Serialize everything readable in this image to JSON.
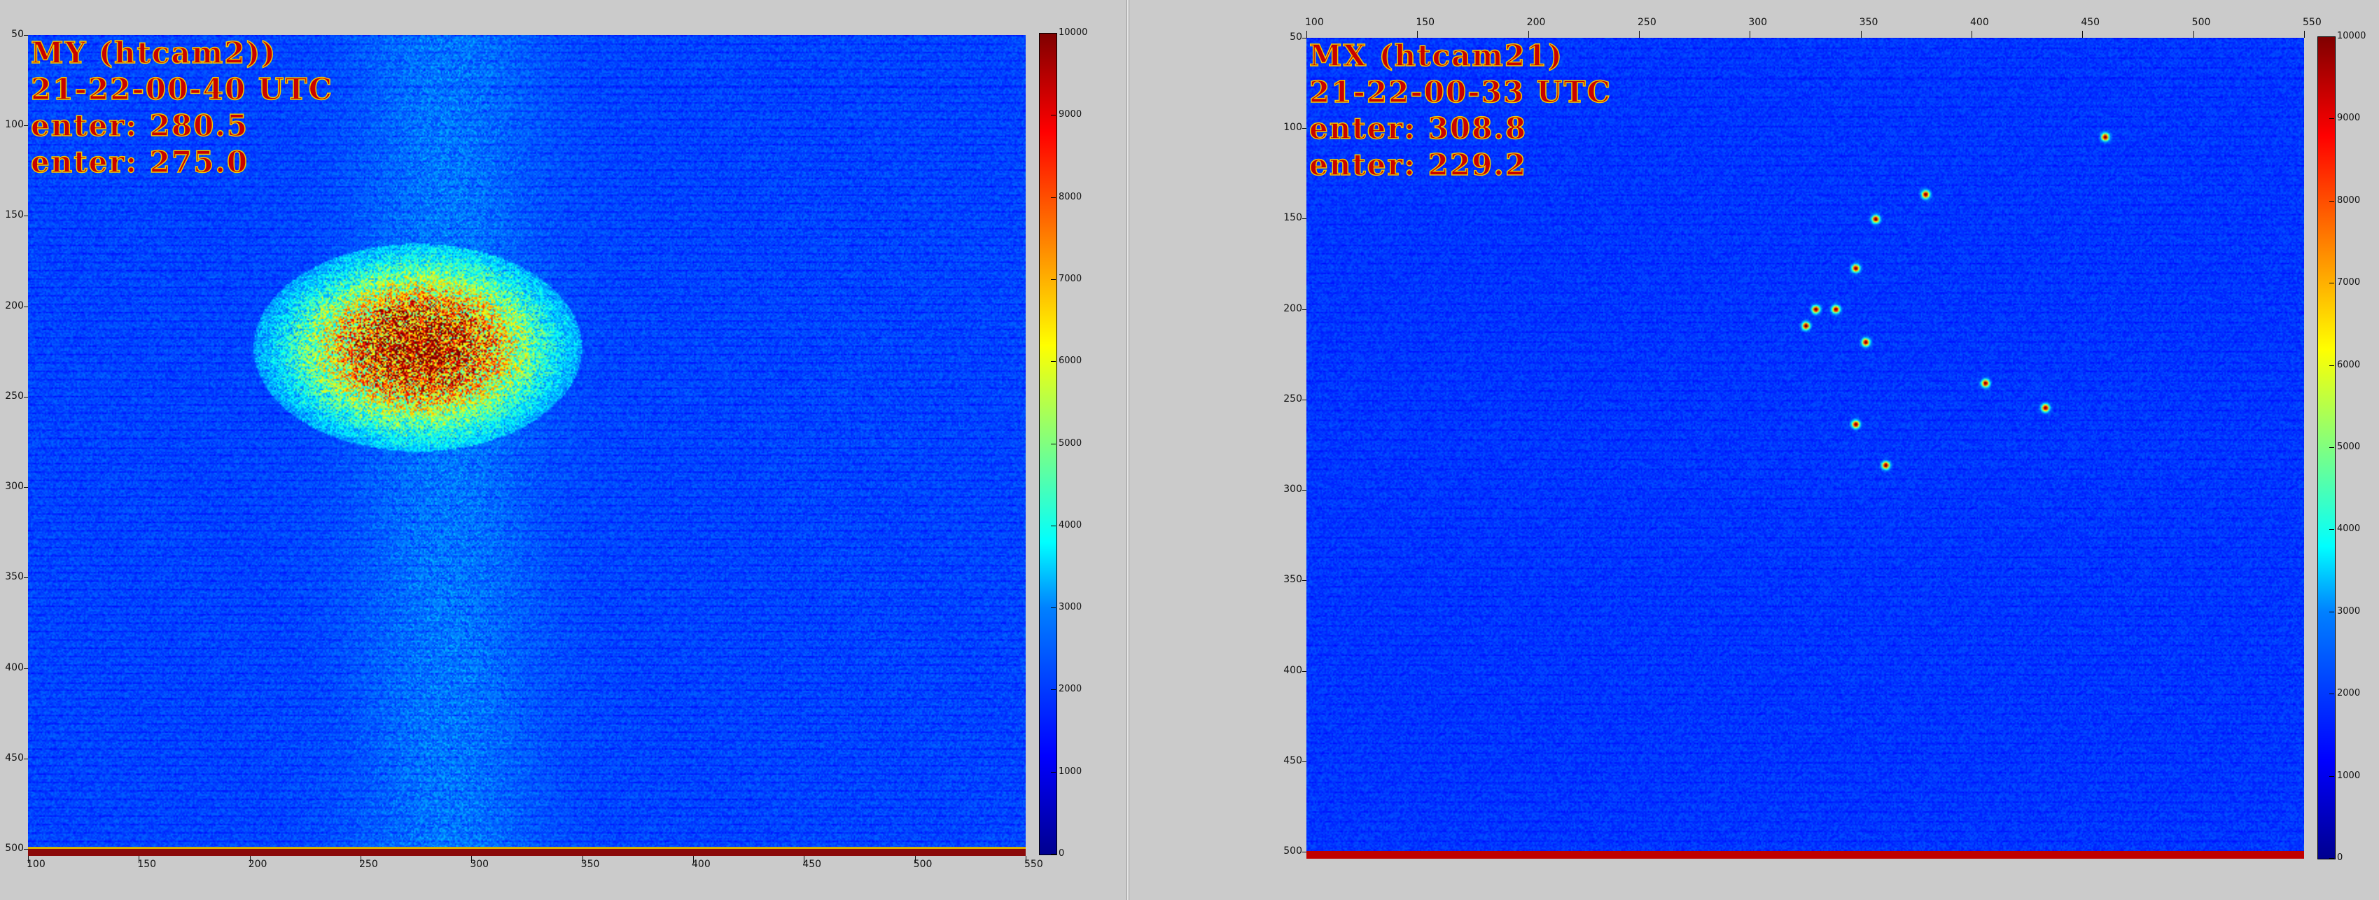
{
  "left_panel": {
    "overlay": [
      "MY (htcam2))",
      "21-22-00-40 UTC",
      "enter: 280.5",
      "enter: 275.0"
    ],
    "y_ticks": [
      "50",
      "100",
      "150",
      "200",
      "250",
      "300",
      "350",
      "400",
      "450",
      "500"
    ],
    "x_ticks": [
      "100",
      "150",
      "200",
      "250",
      "300",
      "350",
      "400",
      "450",
      "500",
      "550"
    ],
    "colorbar_ticks": [
      "0",
      "1000",
      "2000",
      "3000",
      "4000",
      "5000",
      "6000",
      "7000",
      "8000",
      "9000",
      "10000"
    ]
  },
  "right_panel": {
    "overlay": [
      "MX (htcam21)",
      "21-22-00-33 UTC",
      "enter: 308.8",
      "enter: 229.2"
    ],
    "y_ticks": [
      "50",
      "100",
      "150",
      "200",
      "250",
      "300",
      "350",
      "400",
      "450",
      "500"
    ],
    "x_ticks": [
      "100",
      "150",
      "200",
      "250",
      "300",
      "350",
      "400",
      "450",
      "500",
      "550"
    ],
    "colorbar_ticks": [
      "0",
      "1000",
      "2000",
      "3000",
      "4000",
      "5000",
      "6000",
      "7000",
      "8000",
      "9000",
      "10000"
    ]
  },
  "colors": {
    "background": "#0b22c8",
    "hot": "#8b0000",
    "window_bg": "#cbcbcb"
  }
}
